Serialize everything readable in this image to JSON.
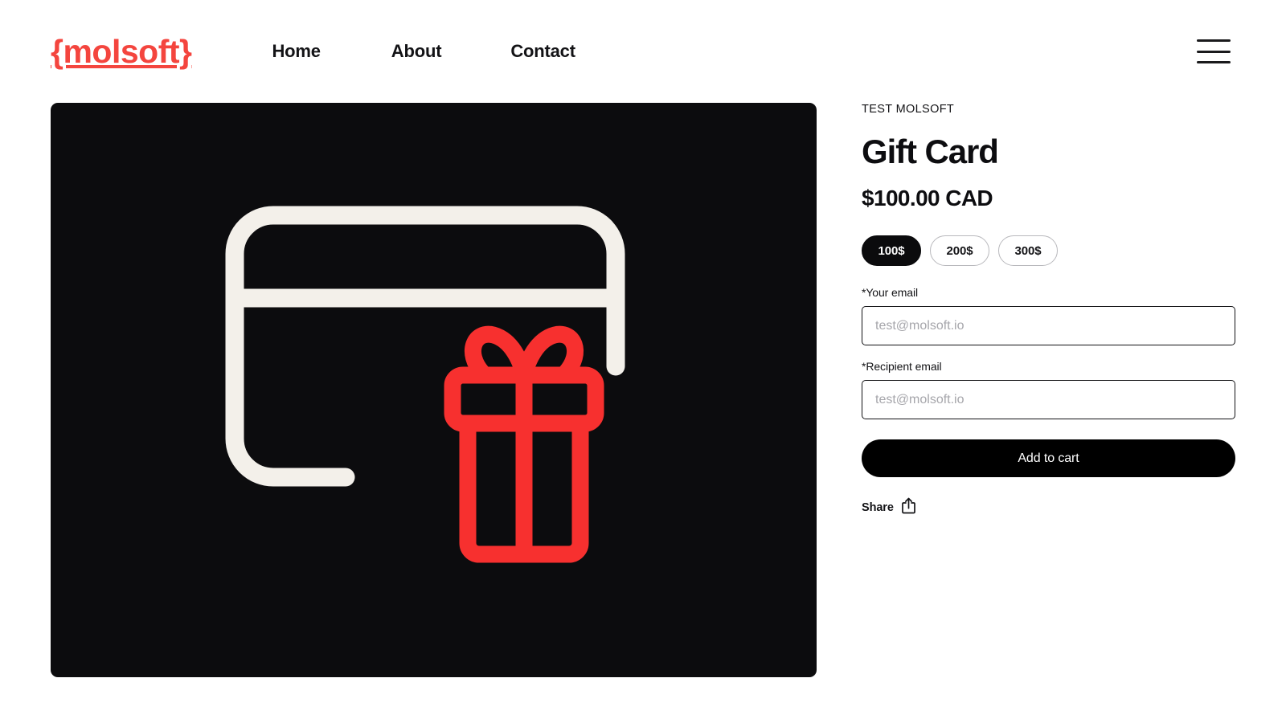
{
  "brand": {
    "logo_text": "{molsoft}",
    "logo_color": "#F4453E"
  },
  "nav": {
    "items": [
      {
        "label": "Home"
      },
      {
        "label": "About"
      },
      {
        "label": "Contact"
      }
    ],
    "menu_icon": "hamburger-menu-icon"
  },
  "gallery": {
    "image_alt": "gift-card-illustration",
    "background_color": "#0C0C0E",
    "card_stroke_color": "#F3F0EA",
    "gift_color": "#F7302F"
  },
  "product": {
    "vendor": "TEST MOLSOFT",
    "title": "Gift Card",
    "price": "$100.00 CAD",
    "variants": [
      {
        "label": "100$",
        "selected": true
      },
      {
        "label": "200$",
        "selected": false
      },
      {
        "label": "300$",
        "selected": false
      }
    ],
    "fields": [
      {
        "label": "*Your email",
        "placeholder": "test@molsoft.io",
        "value": ""
      },
      {
        "label": "*Recipient email",
        "placeholder": "test@molsoft.io",
        "value": ""
      }
    ],
    "add_to_cart_label": "Add to cart",
    "share_label": "Share",
    "share_icon": "share-upload-icon"
  }
}
